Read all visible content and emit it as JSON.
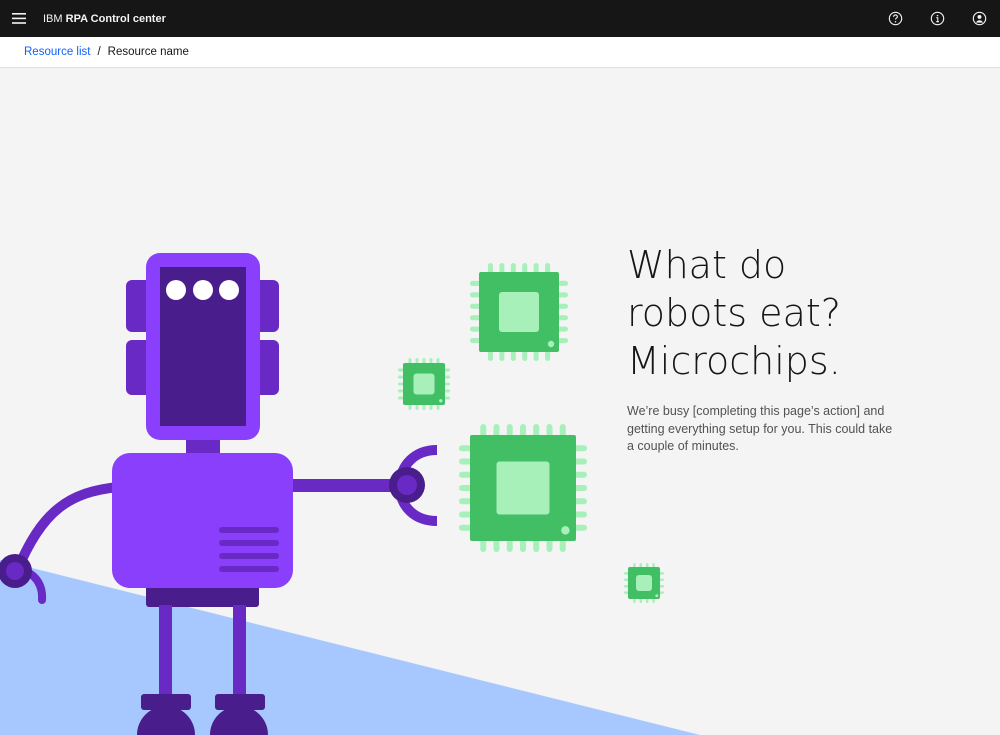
{
  "header": {
    "brand_prefix": "IBM",
    "brand_name": "RPA Control center",
    "menu_icon": "hamburger-menu-icon",
    "actions": [
      {
        "icon": "help-icon"
      },
      {
        "icon": "info-icon"
      },
      {
        "icon": "user-avatar-icon"
      }
    ]
  },
  "breadcrumb": {
    "link_label": "Resource list",
    "separator": "/",
    "current_label": "Resource name"
  },
  "message": {
    "headline_line1": "What do",
    "headline_line2": "robots eat?",
    "headline_line3": "Microchips.",
    "body_line1": "We’re busy [completing this page’s action] and",
    "body_line2": "getting everything setup for you. This could take",
    "body_line3": "a couple of minutes."
  },
  "illustration": {
    "subject": "robot-with-microchips",
    "colors": {
      "robot_purple": "#8a3ffc",
      "robot_dark": "#491d8b",
      "robot_mid": "#6929c4",
      "chip_green": "#42be65",
      "chip_light": "#a7f0ba",
      "floor_blue": "#a6c8ff"
    }
  }
}
